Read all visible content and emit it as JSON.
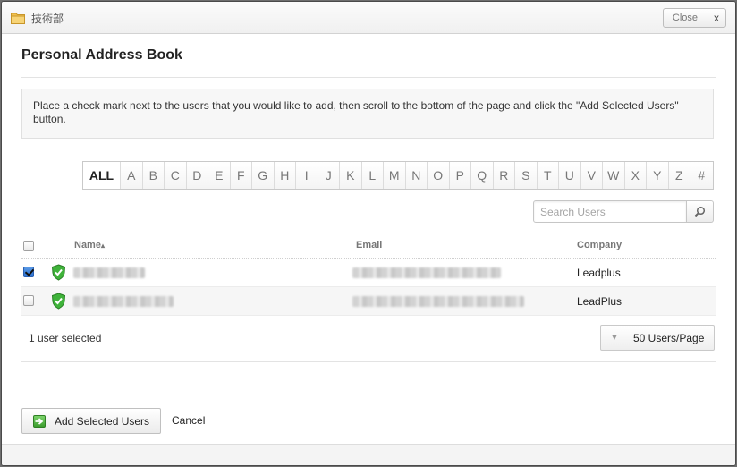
{
  "window": {
    "title": "技術部",
    "close_label": "Close",
    "close_x": "x"
  },
  "page": {
    "title": "Personal Address Book",
    "instructions": "Place a check mark next to the users that you would like to add, then scroll to the bottom of the page and click the \"Add Selected Users\" button."
  },
  "alphabet": [
    "ALL",
    "A",
    "B",
    "C",
    "D",
    "E",
    "F",
    "G",
    "H",
    "I",
    "J",
    "K",
    "L",
    "M",
    "N",
    "O",
    "P",
    "Q",
    "R",
    "S",
    "T",
    "U",
    "V",
    "W",
    "X",
    "Y",
    "Z",
    "#"
  ],
  "search": {
    "placeholder": "Search Users"
  },
  "table": {
    "columns": {
      "name": "Name",
      "sort_indicator": "▴",
      "email": "Email",
      "company": "Company"
    },
    "rows": [
      {
        "checked": true,
        "company": "Leadplus"
      },
      {
        "checked": false,
        "company": "LeadPlus"
      }
    ]
  },
  "status": {
    "selected_count": "1 user selected"
  },
  "pagination": {
    "per_page_label": "50 Users/Page"
  },
  "actions": {
    "add_label": "Add Selected Users",
    "cancel_label": "Cancel"
  },
  "colors": {
    "check_accent": "#2a6fd0",
    "shield": "#3fb33a",
    "add_icon": "#3d9d2f"
  }
}
